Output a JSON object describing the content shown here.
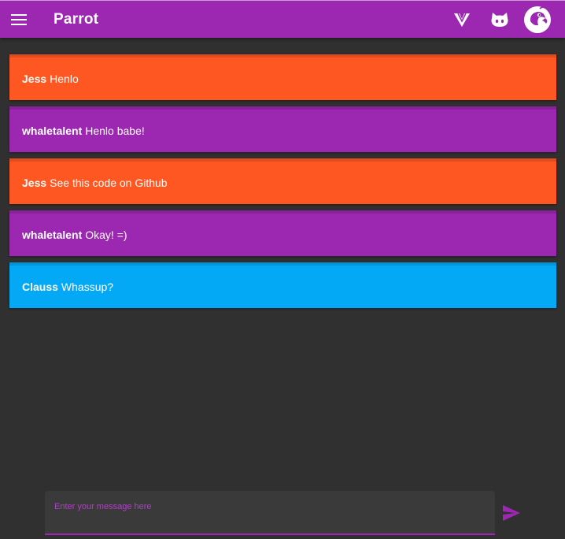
{
  "app": {
    "title": "Parrot",
    "accent_color": "#9c27b0"
  },
  "toolbar": {
    "menu_icon": "menu-icon",
    "actions": [
      {
        "icon": "vuetify-icon"
      },
      {
        "icon": "github-icon"
      },
      {
        "icon": "parrot-avatar-icon"
      }
    ]
  },
  "messages": [
    {
      "author": "Jess",
      "text": "Henlo",
      "color": "#ff5722"
    },
    {
      "author": "whaletalent",
      "text": "Henlo babe!",
      "color": "#9c27b0"
    },
    {
      "author": "Jess",
      "text": "See this code on Github",
      "color": "#ff5722"
    },
    {
      "author": "whaletalent",
      "text": "Okay! =)",
      "color": "#9c27b0"
    },
    {
      "author": "Clauss",
      "text": "Whassup?",
      "color": "#03a9f4"
    }
  ],
  "composer": {
    "label": "Enter your message here",
    "value": "",
    "send_icon": "send-icon"
  }
}
